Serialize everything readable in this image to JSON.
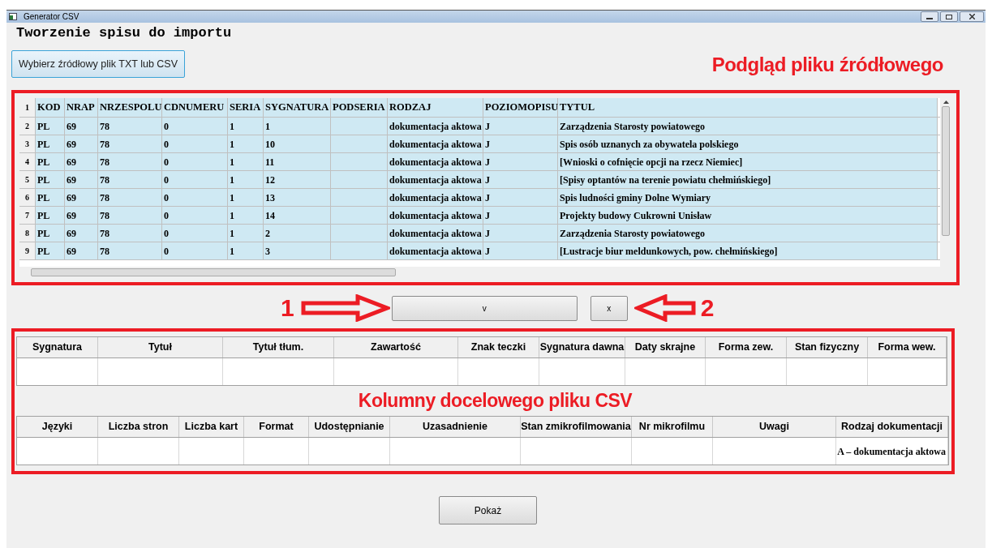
{
  "window": {
    "title": "Generator CSV"
  },
  "heading": "Tworzenie spisu do importu",
  "choose_button": "Wybierz źródłowy plik TXT lub CSV",
  "preview_label": "Podgląd pliku źródłowego",
  "source_table": {
    "header_number": "1",
    "columns": [
      "KOD",
      "NRAP",
      "NRZESPOLU",
      "CDNUMERU",
      "SERIA",
      "SYGNATURA",
      "PODSERIA",
      "RODZAJ",
      "POZIOMOPISU",
      "TYTUL"
    ],
    "rows": [
      {
        "number": "2",
        "cells": [
          "PL",
          "69",
          "78",
          "0",
          "1",
          "1",
          null,
          "dokumentacja aktowa",
          "J",
          "Zarządzenia Starosty powiatowego"
        ]
      },
      {
        "number": "3",
        "cells": [
          "PL",
          "69",
          "78",
          "0",
          "1",
          "10",
          null,
          "dokumentacja aktowa",
          "J",
          "Spis osób uznanych za obywatela polskiego"
        ]
      },
      {
        "number": "4",
        "cells": [
          "PL",
          "69",
          "78",
          "0",
          "1",
          "11",
          null,
          "dokumentacja aktowa",
          "J",
          "[Wnioski o cofnięcie opcji na rzecz Niemiec]"
        ]
      },
      {
        "number": "5",
        "cells": [
          "PL",
          "69",
          "78",
          "0",
          "1",
          "12",
          null,
          "dokumentacja aktowa",
          "J",
          "[Spisy optantów na terenie powiatu chełmińskiego]"
        ]
      },
      {
        "number": "6",
        "cells": [
          "PL",
          "69",
          "78",
          "0",
          "1",
          "13",
          null,
          "dokumentacja aktowa",
          "J",
          "Spis ludności gminy Dolne Wymiary"
        ]
      },
      {
        "number": "7",
        "cells": [
          "PL",
          "69",
          "78",
          "0",
          "1",
          "14",
          null,
          "dokumentacja aktowa",
          "J",
          "Projekty budowy Cukrowni Unisław"
        ]
      },
      {
        "number": "8",
        "cells": [
          "PL",
          "69",
          "78",
          "0",
          "1",
          "2",
          null,
          "dokumentacja aktowa",
          "J",
          "Zarządzenia Starosty powiatowego"
        ]
      },
      {
        "number": "9",
        "cells": [
          "PL",
          "69",
          "78",
          "0",
          "1",
          "3",
          null,
          "dokumentacja aktowa",
          "J",
          "[Lustracje biur meldunkowych, pow. chełmińskiego]"
        ]
      }
    ]
  },
  "arrow_left_label": "1",
  "move_button": "v",
  "remove_button": "x",
  "arrow_right_label": "2",
  "target_label": "Kolumny docelowego pliku CSV",
  "target_tables": [
    {
      "columns": [
        {
          "label": "Sygnatura"
        },
        {
          "label": "Tytuł"
        },
        {
          "label": "Tytuł tłum."
        },
        {
          "label": "Zawartość"
        },
        {
          "label": "Znak teczki"
        },
        {
          "label": "Sygnatura dawna"
        },
        {
          "label": "Daty skrajne"
        },
        {
          "label": "Forma zew."
        },
        {
          "label": "Stan fizyczny"
        },
        {
          "label": "Forma wew."
        }
      ]
    },
    {
      "columns": [
        {
          "label": "Języki"
        },
        {
          "label": "Liczba stron"
        },
        {
          "label": "Liczba kart"
        },
        {
          "label": "Format"
        },
        {
          "label": "Udostępnianie"
        },
        {
          "label": "Uzasadnienie"
        },
        {
          "label": "Stan zmikrofilmowania"
        },
        {
          "label": "Nr mikrofilmu"
        },
        {
          "label": "Uwagi"
        },
        {
          "label": "Rodzaj dokumentacji",
          "value": "A – dokumentacja aktowa"
        }
      ]
    }
  ],
  "show_button": "Pokaż"
}
